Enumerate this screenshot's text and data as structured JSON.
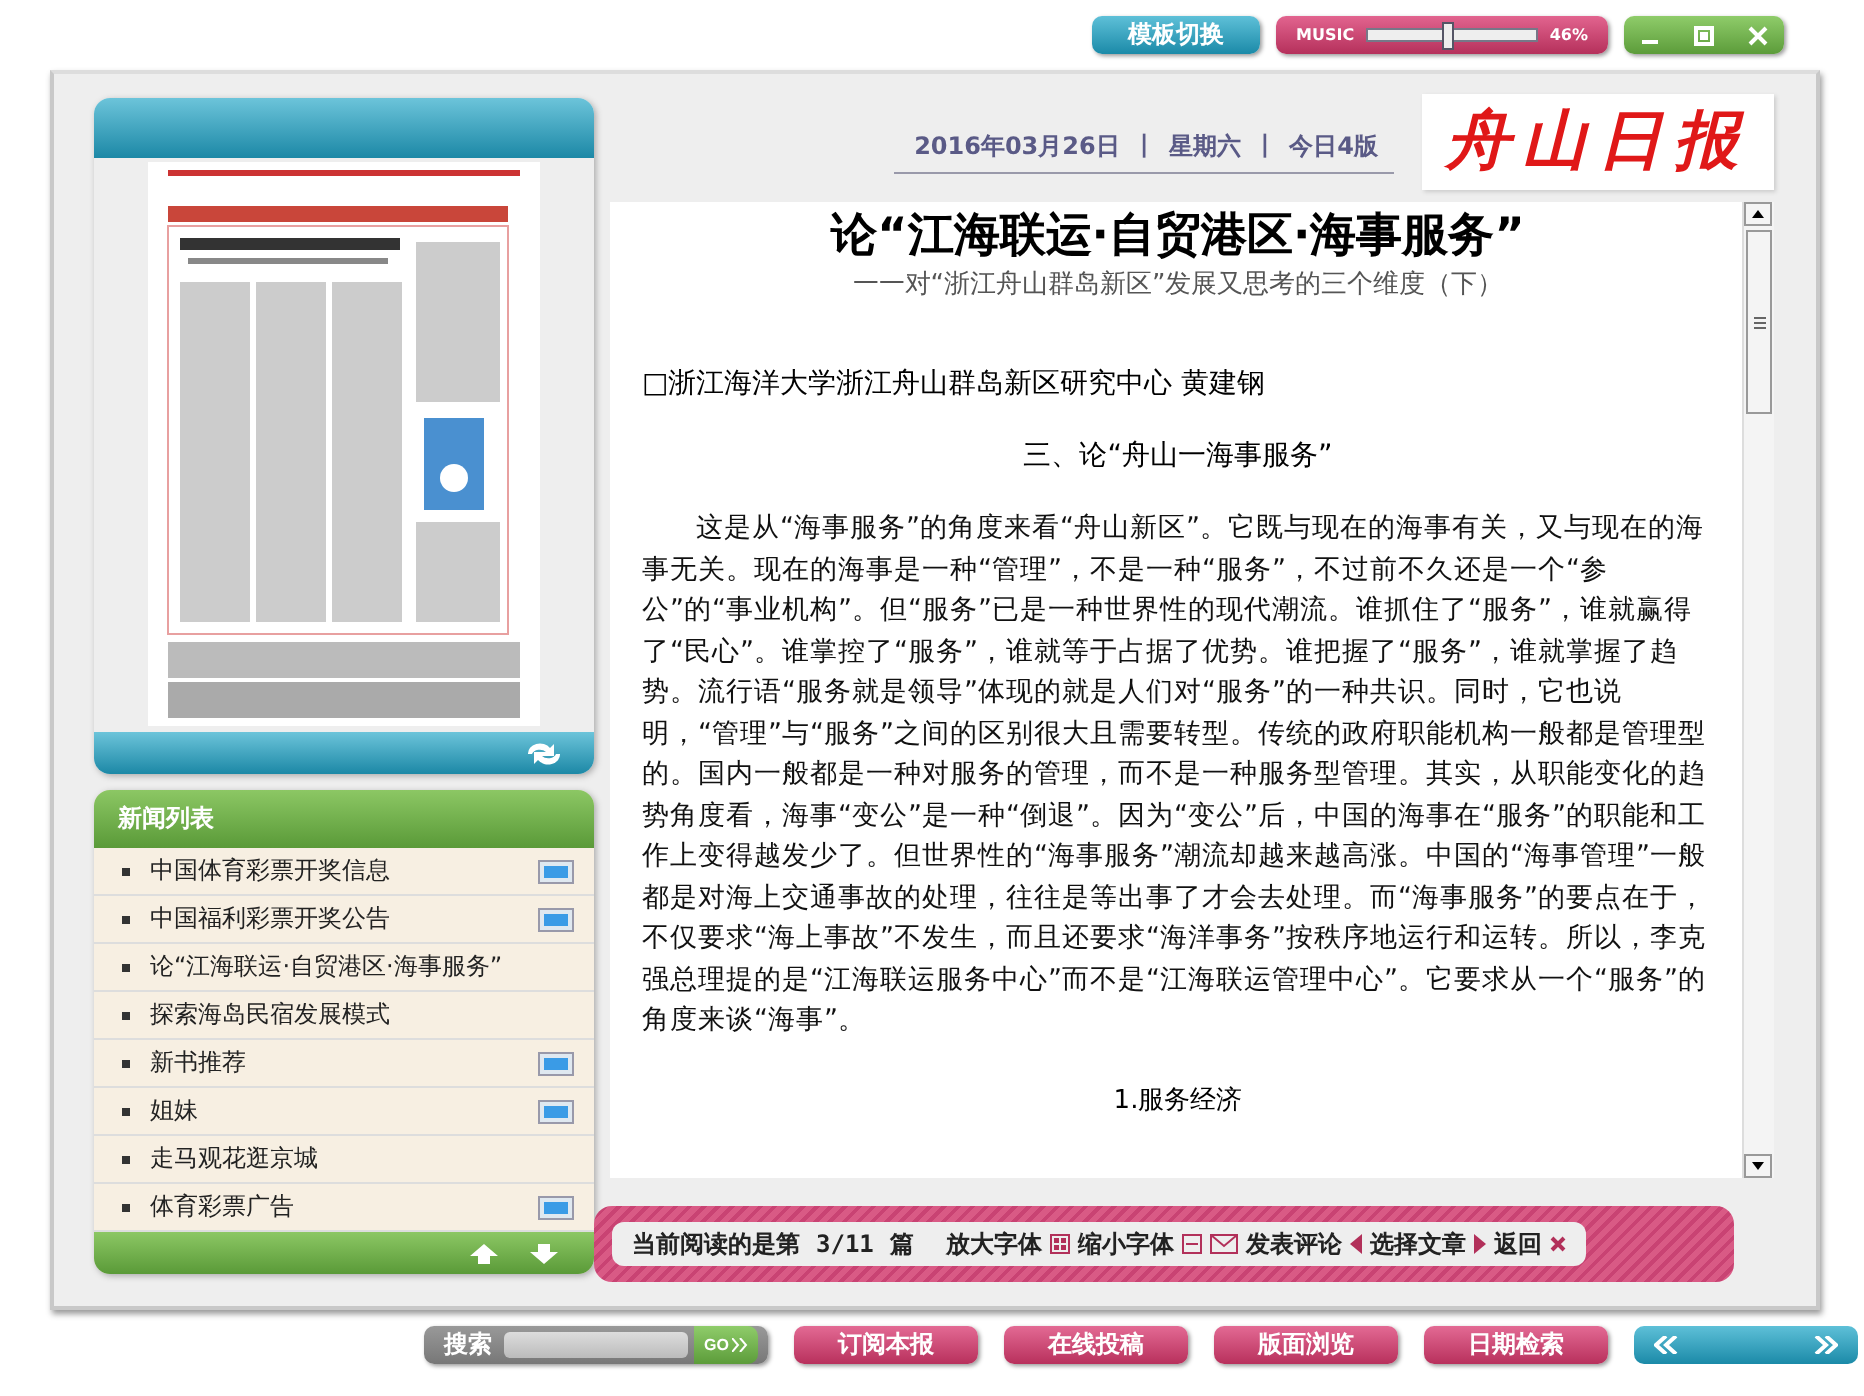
{
  "top_bar": {
    "template_button": "模板切换",
    "music": {
      "label": "MUSIC",
      "level": 0.46,
      "reading": "46%"
    }
  },
  "news_list": {
    "title": "新闻列表",
    "items": [
      {
        "title": "中国体育彩票开奖信息",
        "has_picture": true
      },
      {
        "title": "中国福利彩票开奖公告",
        "has_picture": true
      },
      {
        "title": "论“江海联运·自贸港区·海事服务”",
        "has_picture": false
      },
      {
        "title": "探索海岛民宿发展模式",
        "has_picture": false
      },
      {
        "title": "新书推荐",
        "has_picture": true
      },
      {
        "title": "姐妹",
        "has_picture": true
      },
      {
        "title": "走马观花逛京城",
        "has_picture": false
      },
      {
        "title": "体育彩票广告",
        "has_picture": true
      }
    ]
  },
  "header": {
    "date_line": [
      "2016年03月26日",
      "|",
      "星期六",
      "|",
      "今日4版"
    ],
    "logo": "舟山日报"
  },
  "article": {
    "title": "论“江海联运·自贸港区·海事服务”",
    "subtitle": "一一对“浙江舟山群岛新区”发展又思考的三个维度（下）",
    "byline": "□浙江海洋大学浙江舟山群岛新区研究中心  黄建钢",
    "section_heading": "三、论“舟山一海事服务”",
    "paragraph": "这是从“海事服务”的角度来看“舟山新区”。它既与现在的海事有关，又与现在的海事无关。现在的海事是一种“管理”，不是一种“服务”，不过前不久还是一个“参公”的“事业机构”。但“服务”已是一种世界性的现代潮流。谁抓住了“服务”，谁就赢得了“民心”。谁掌控了“服务”，谁就等于占据了优势。谁把握了“服务”，谁就掌握了趋势。流行语“服务就是领导”体现的就是人们对“服务”的一种共识。同时，它也说明，“管理”与“服务”之间的区别很大且需要转型。传统的政府职能机构一般都是管理型的。国内一般都是一种对服务的管理，而不是一种服务型管理。其实，从职能变化的趋势角度看，海事“变公”是一种“倒退”。因为“变公”后，中国的海事在“服务”的职能和工作上变得越发少了。但世界性的“海事服务”潮流却越来越高涨。中国的“海事管理”一般都是对海上交通事故的处理，往往是等出事了才会去处理。而“海事服务”的要点在于，不仅要求“海上事故”不发生，而且还要求“海洋事务”按秩序地运行和运转。所以，李克强总理提的是“江海联运服务中心”而不是“江海联运管理中心”。它要求从一个“服务”的角度来谈“海事”。",
    "subheading": "1.服务经济"
  },
  "reading_bar": {
    "status_label": "当前阅读的是第",
    "position": "3/11",
    "unit": "篇",
    "enlarge": "放大字体",
    "shrink": "缩小字体",
    "comment": "发表评论",
    "choose": "选择文章",
    "back": "返回"
  },
  "bottom_bar": {
    "search_label": "搜索",
    "go": "GO",
    "buttons": [
      "订阅本报",
      "在线投稿",
      "版面浏览",
      "日期检索"
    ]
  }
}
